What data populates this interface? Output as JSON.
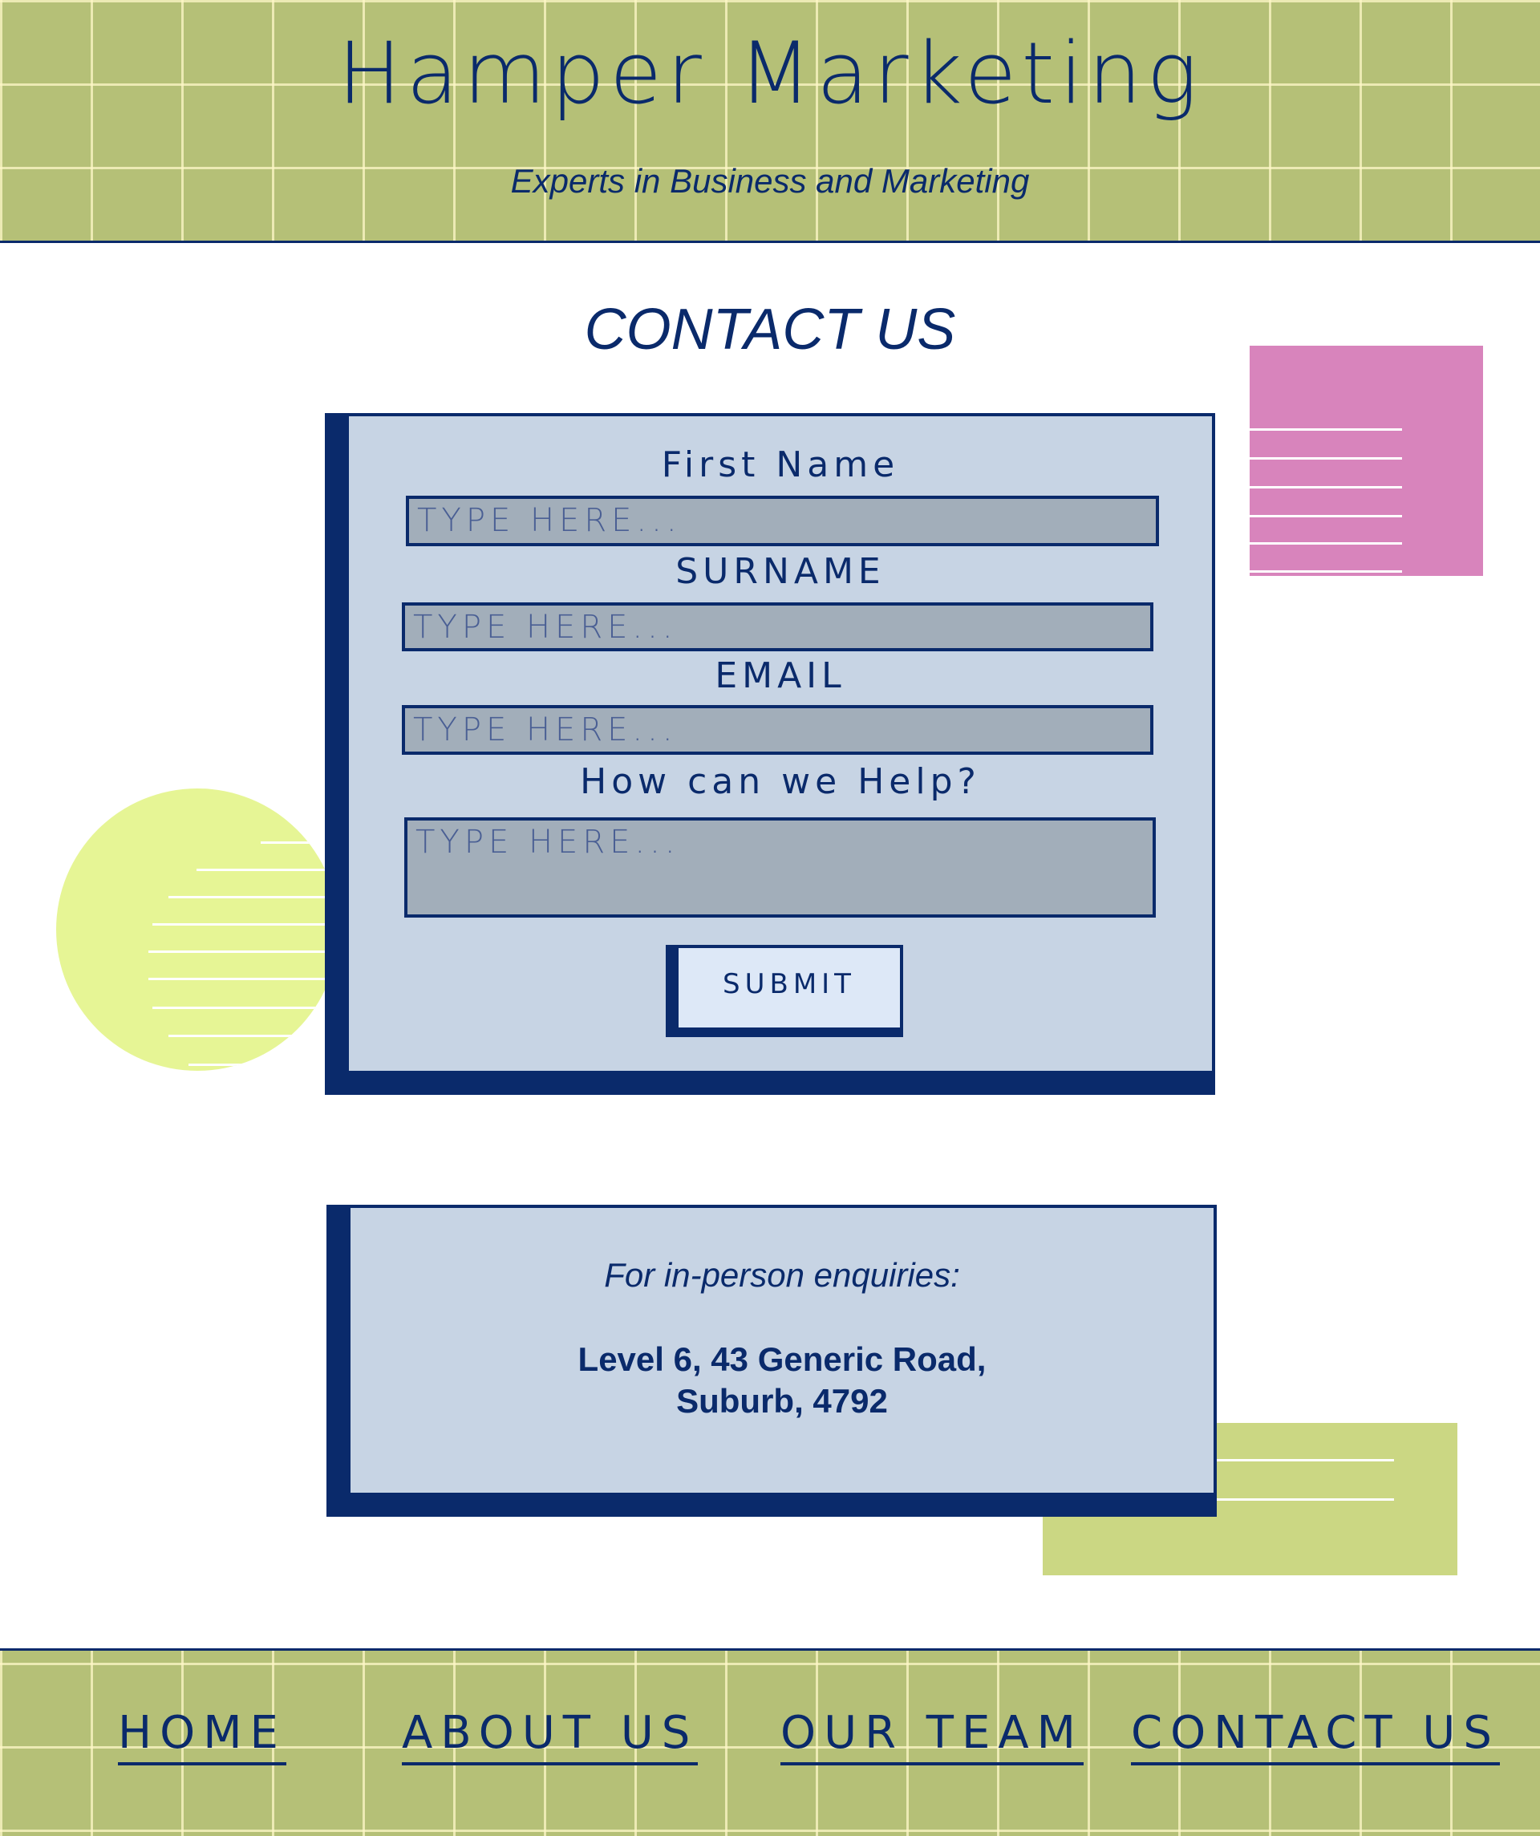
{
  "header": {
    "title": "Hamper Marketing",
    "subtitle": "Experts in Business and Marketing"
  },
  "main": {
    "heading": "CONTACT US",
    "form": {
      "fields": [
        {
          "label": "First Name",
          "placeholder": "TYPE HERE..."
        },
        {
          "label": "SURNAME",
          "placeholder": "TYPE HERE..."
        },
        {
          "label": "EMAIL",
          "placeholder": "TYPE HERE..."
        },
        {
          "label": "How can we Help?",
          "placeholder": "TYPE HERE..."
        }
      ],
      "submit_label": "SUBMIT"
    },
    "address": {
      "intro": "For in-person enquiries:",
      "line1": "Level 6, 43 Generic Road,",
      "line2": "Suburb, 4792"
    }
  },
  "footer": {
    "nav": [
      {
        "label": "HOME"
      },
      {
        "label": "ABOUT US"
      },
      {
        "label": "OUR TEAM"
      },
      {
        "label": "CONTACT US"
      }
    ]
  },
  "colors": {
    "navy": "#0a2a6b",
    "band_green": "#b5c077",
    "card_blue": "#c7d4e4",
    "field_gray": "#a2aeba",
    "pink": "#d884bc",
    "lime": "#e6f595",
    "olive": "#cbd783"
  }
}
